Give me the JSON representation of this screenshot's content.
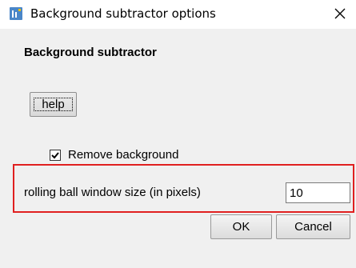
{
  "window": {
    "title": "Background subtractor options",
    "app_icon": "imagej-icon",
    "close_icon": "close-icon"
  },
  "dialog": {
    "section_title": "Background subtractor",
    "help_button_label": "help",
    "remove_background": {
      "label": "Remove background",
      "checked": true
    },
    "rolling_ball": {
      "label": "rolling ball window size (in pixels)",
      "value": "10"
    },
    "ok_label": "OK",
    "cancel_label": "Cancel"
  },
  "colors": {
    "highlight_border": "#e02020",
    "dialog_background": "#f0f0f0",
    "icon_blue": "#4a86c8"
  }
}
